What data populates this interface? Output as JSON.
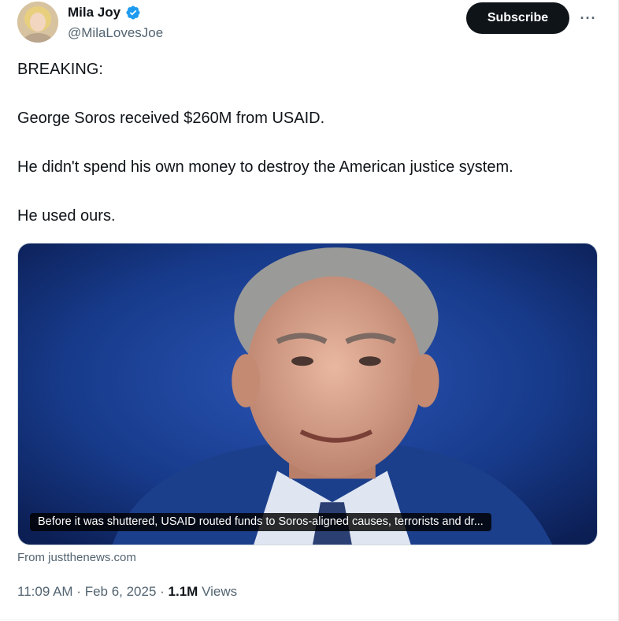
{
  "author": {
    "display_name": "Mila Joy",
    "handle": "@MilaLovesJoe",
    "verified_icon": "verified-badge-icon",
    "verified_color": "#1d9bf0"
  },
  "actions": {
    "subscribe_label": "Subscribe",
    "more_label": "···"
  },
  "tweet": {
    "lines": [
      "BREAKING:",
      "George Soros received $260M from USAID.",
      "He didn't spend his own money to destroy the American justice system.",
      "He used ours."
    ]
  },
  "media": {
    "caption": "Before it was shuttered, USAID routed funds to Soros-aligned causes, terrorists and dr...",
    "source": "From justthenews.com"
  },
  "meta": {
    "time": "11:09 AM",
    "separator": " · ",
    "date": "Feb 6, 2025",
    "views_count": "1.1M",
    "views_label": " Views"
  },
  "colors": {
    "text_primary": "#0f1419",
    "text_secondary": "#536471",
    "button_bg": "#0f1419",
    "media_bg": "#1d3f8f"
  }
}
